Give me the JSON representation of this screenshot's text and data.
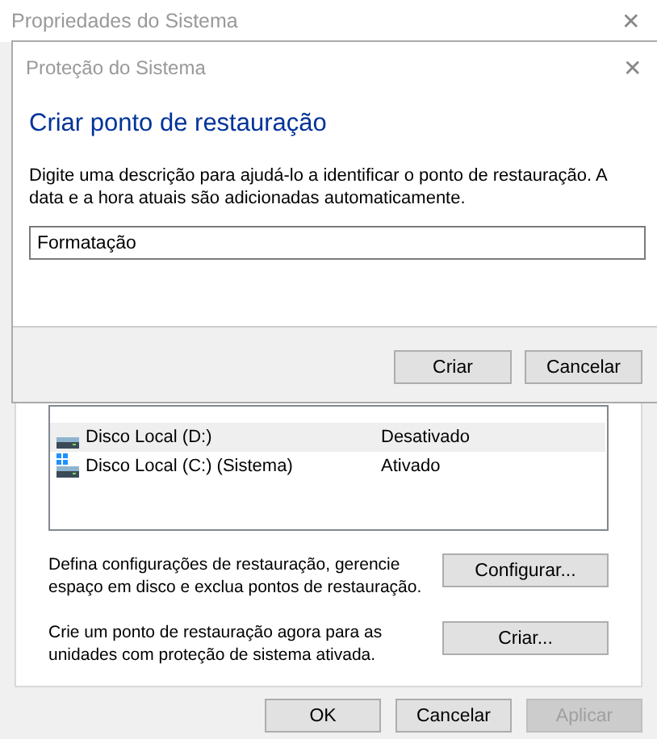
{
  "window": {
    "title": "Propriedades do Sistema",
    "close": "✕"
  },
  "drives": [
    {
      "name": "Disco Local (D:)",
      "protection": "Desativado",
      "system": false,
      "selected": true
    },
    {
      "name": "Disco Local (C:) (Sistema)",
      "protection": "Ativado",
      "system": true,
      "selected": false
    }
  ],
  "actions": [
    {
      "text": "Defina configurações de restauração, gerencie espaço em disco e exclua pontos de restauração.",
      "button": "Configurar..."
    },
    {
      "text": "Crie um ponto de restauração agora para as unidades com proteção de sistema ativada.",
      "button": "Criar..."
    }
  ],
  "buttons": [
    {
      "label": "OK",
      "disabled": false
    },
    {
      "label": "Cancelar",
      "disabled": false
    },
    {
      "label": "Aplicar",
      "disabled": true
    }
  ],
  "dialog": {
    "title": "Proteção do Sistema",
    "close": "✕",
    "heading": "Criar ponto de restauração",
    "description": "Digite uma descrição para ajudá-lo a identificar o ponto de restauração. A data e a hora atuais são adicionadas automaticamente.",
    "value": "Formatação",
    "buttons": [
      "Criar",
      "Cancelar"
    ]
  }
}
